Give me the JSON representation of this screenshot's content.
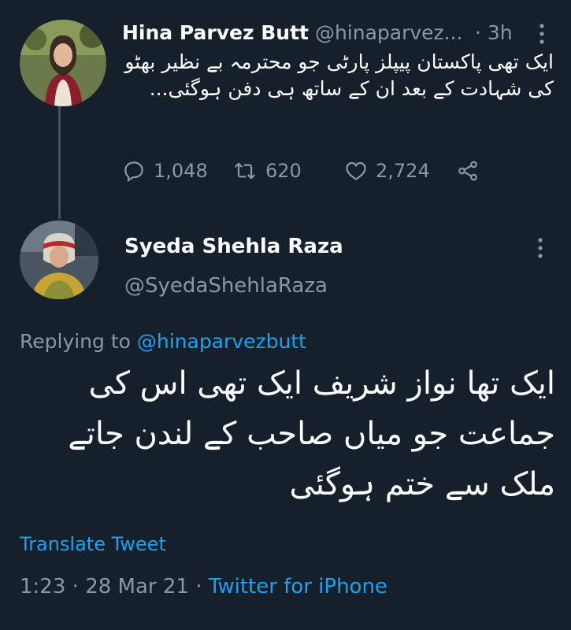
{
  "tweet1": {
    "author_name": "Hina Parvez Butt",
    "author_handle": "@hinaparvez...",
    "separator": "·",
    "time": "3h",
    "body": "ایک تھی پاکستان پیپلز پارٹی جو محترمہ بے نظیر بھٹو کی شہادت کے بعد ان کے ساتھ ہی دفن ہوگئی...",
    "actions": {
      "replies": "1,048",
      "retweets": "620",
      "likes": "2,724"
    },
    "icons": [
      "reply-icon",
      "retweet-icon",
      "like-icon",
      "share-icon",
      "more-options-icon"
    ]
  },
  "tweet2": {
    "author_name": "Syeda Shehla Raza",
    "author_handle": "@SyedaShehlaRaza",
    "replying_prefix": "Replying to ",
    "replying_to": "@hinaparvezbutt",
    "body": "ایک تھا نواز شریف ایک تھی اس کی جماعت جو میاں صاحب کے لندن جاتے ملک سے ختم ہوگئی",
    "translate_label": "Translate Tweet",
    "time": "1:23",
    "dot1": " · ",
    "date": "28 Mar 21",
    "dot2": " · ",
    "source": "Twitter for iPhone"
  },
  "colors": {
    "background": "#15202b",
    "secondary_text": "#8899a6",
    "link": "#1da1f2",
    "thread_line": "#3d5466"
  }
}
